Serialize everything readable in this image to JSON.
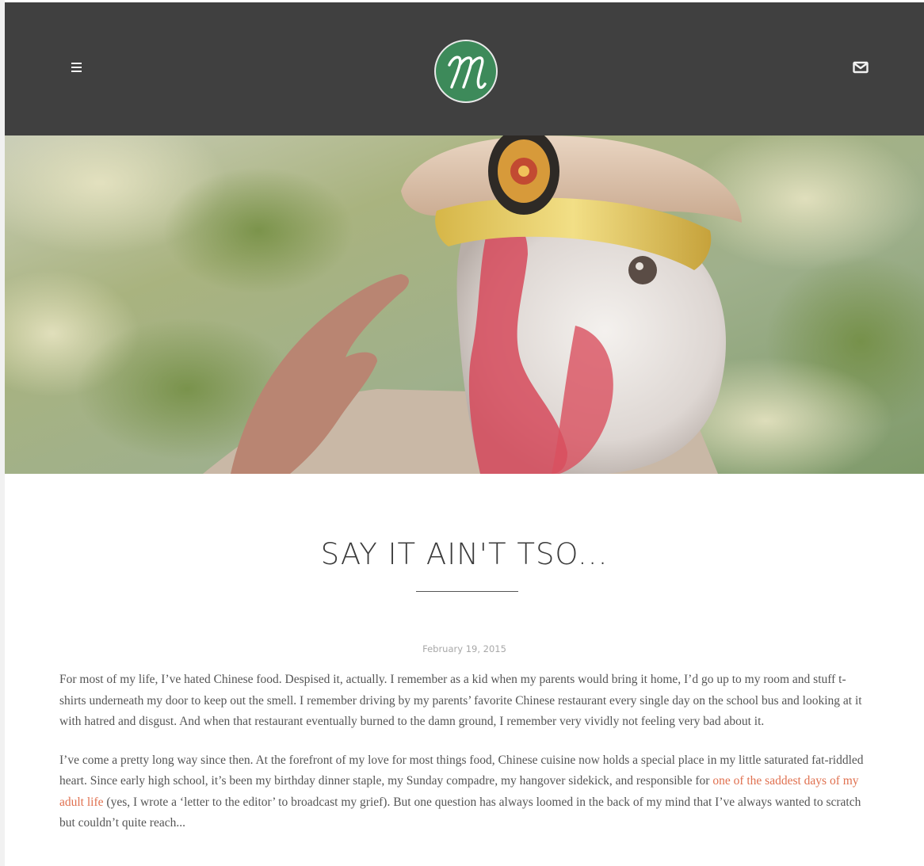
{
  "header": {
    "menu_icon": "hamburger-menu-icon",
    "logo_letter": "M",
    "mail_icon": "envelope-icon",
    "brand_color": "#3d8a5a",
    "bar_color": "#404040"
  },
  "hero": {
    "description_icon": "hero-image"
  },
  "post": {
    "title": "SAY IT AIN'T TSO...",
    "date": "February 19, 2015",
    "p1": "For most of my life, I’ve hated Chinese food. Despised it, actually. I remember as a kid when my parents would bring it home, I’d go up to my room and stuff t-shirts underneath my door to keep out the smell. I remember driving by my parents’ favorite Chinese restaurant every single day on the school bus and looking at it with hatred and disgust. And when that restaurant eventually burned to the damn ground, I remember very vividly not feeling very bad about it.",
    "p2_before": "I’ve come a pretty long way since then. At the forefront of my love for most things food, Chinese cuisine now holds a special place in my little saturated fat-riddled heart. Since early high school, it’s been my birthday dinner staple, my Sunday compadre, my hangover sidekick, and responsible for ",
    "p2_link": "one of the saddest days of my adult life",
    "p2_after": " (yes, I wrote a ‘letter to the editor’ to broadcast my grief). But one question has always loomed in the back of my mind that I’ve always wanted to scratch but couldn’t quite reach...",
    "link_color": "#e0704f"
  }
}
